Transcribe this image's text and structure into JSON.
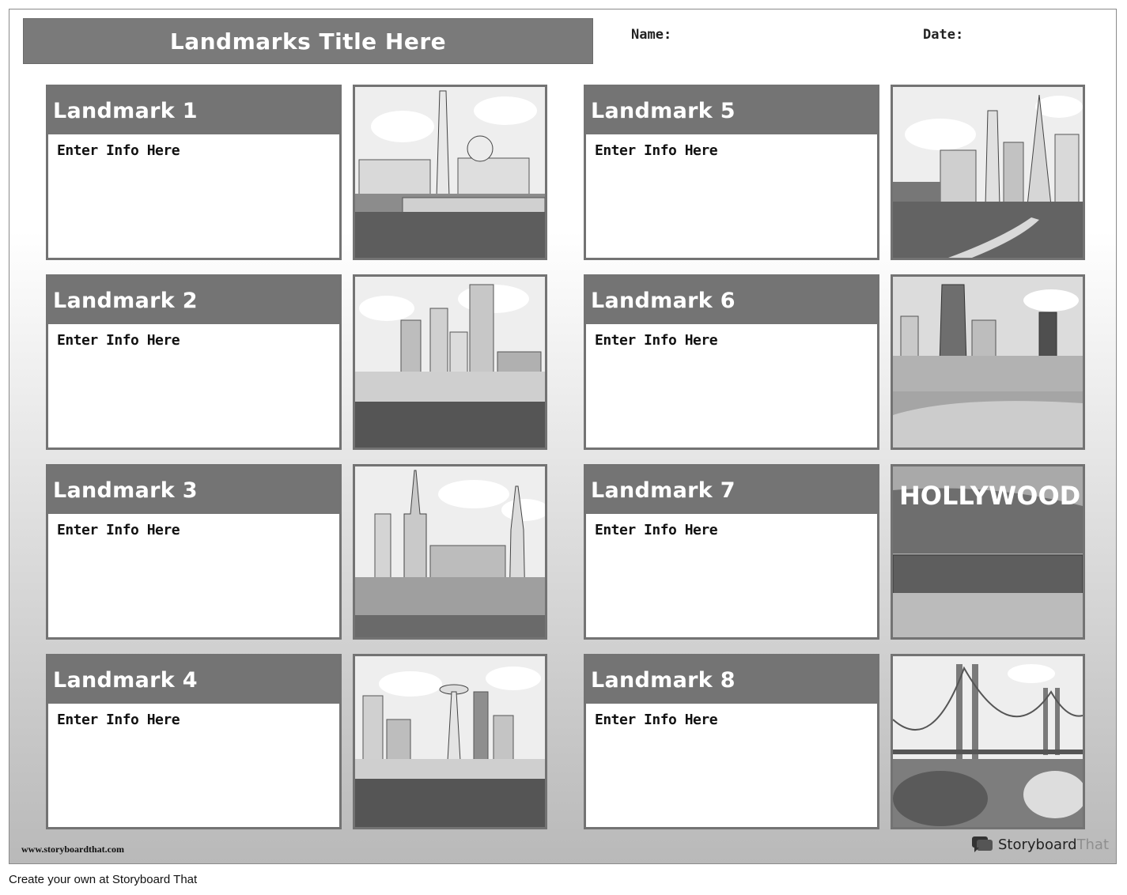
{
  "worksheet": {
    "title": "Landmarks Title Here",
    "name_label": "Name:",
    "date_label": "Date:"
  },
  "landmarks": [
    {
      "title": "Landmark 1",
      "info": "Enter Info Here",
      "image_icon": "washington-dc-skyline-icon"
    },
    {
      "title": "Landmark 2",
      "info": "Enter Info Here",
      "image_icon": "boston-skyline-icon"
    },
    {
      "title": "Landmark 3",
      "info": "Enter Info Here",
      "image_icon": "new-york-skyline-icon"
    },
    {
      "title": "Landmark 4",
      "info": "Enter Info Here",
      "image_icon": "seattle-space-needle-icon"
    },
    {
      "title": "Landmark 5",
      "info": "Enter Info Here",
      "image_icon": "san-francisco-skyline-icon"
    },
    {
      "title": "Landmark 6",
      "info": "Enter Info Here",
      "image_icon": "chicago-skyline-icon"
    },
    {
      "title": "Landmark 7",
      "info": "Hollywood sign image",
      "info_display": "Enter Info Here",
      "image_icon": "hollywood-sign-icon",
      "image_text": "HOLLYWOOD"
    },
    {
      "title": "Landmark 8",
      "info": "Enter Info Here",
      "image_icon": "golden-gate-bridge-icon"
    }
  ],
  "footer": {
    "site_url": "www.storyboardthat.com",
    "brand_name_bold": "Storyboard",
    "brand_name_light": "That",
    "cta": "Create your own at Storyboard That"
  },
  "colors": {
    "header_fill": "#747474",
    "card_border": "#737373",
    "title_text": "#ffffff"
  }
}
